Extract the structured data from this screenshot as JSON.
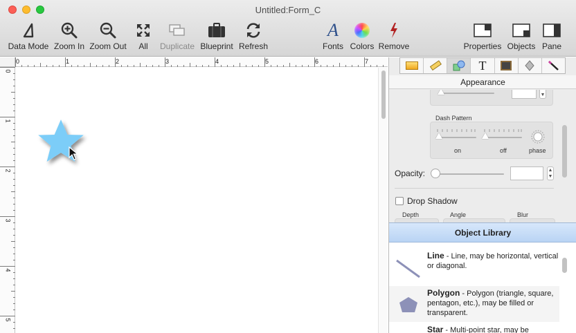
{
  "window": {
    "title": "Untitled:Form_C"
  },
  "toolbar": {
    "data_mode": "Data Mode",
    "zoom_in": "Zoom In",
    "zoom_out": "Zoom Out",
    "all": "All",
    "duplicate": "Duplicate",
    "blueprint": "Blueprint",
    "refresh": "Refresh",
    "fonts": "Fonts",
    "colors": "Colors",
    "remove": "Remove",
    "properties": "Properties",
    "objects": "Objects",
    "pane": "Pane"
  },
  "ruler": {
    "top_labels": [
      "0",
      "1",
      "2",
      "3",
      "4",
      "5",
      "6",
      "7"
    ],
    "left_labels": [
      "0",
      "1",
      "2",
      "3",
      "4",
      "5"
    ]
  },
  "canvas": {
    "shape_color": "#7ccdf8"
  },
  "inspector": {
    "section_title": "Appearance",
    "dash_pattern_label": "Dash Pattern",
    "dash_on_label": "on",
    "dash_off_label": "off",
    "dash_phase_label": "phase",
    "opacity_label": "Opacity:",
    "opacity_value": "",
    "drop_shadow_label": "Drop Shadow",
    "drop_shadow_checked": false,
    "depth_label": "Depth",
    "angle_label": "Angle",
    "blur_label": "Blur"
  },
  "library": {
    "title": "Object Library",
    "items": [
      {
        "name": "Line",
        "desc": "Line, may be horizontal, vertical or diagonal."
      },
      {
        "name": "Polygon",
        "desc": "Polygon (triangle, square, pentagon, etc.), may be filled or transparent."
      },
      {
        "name": "Star",
        "desc": "Multi-point star, may be"
      }
    ]
  }
}
